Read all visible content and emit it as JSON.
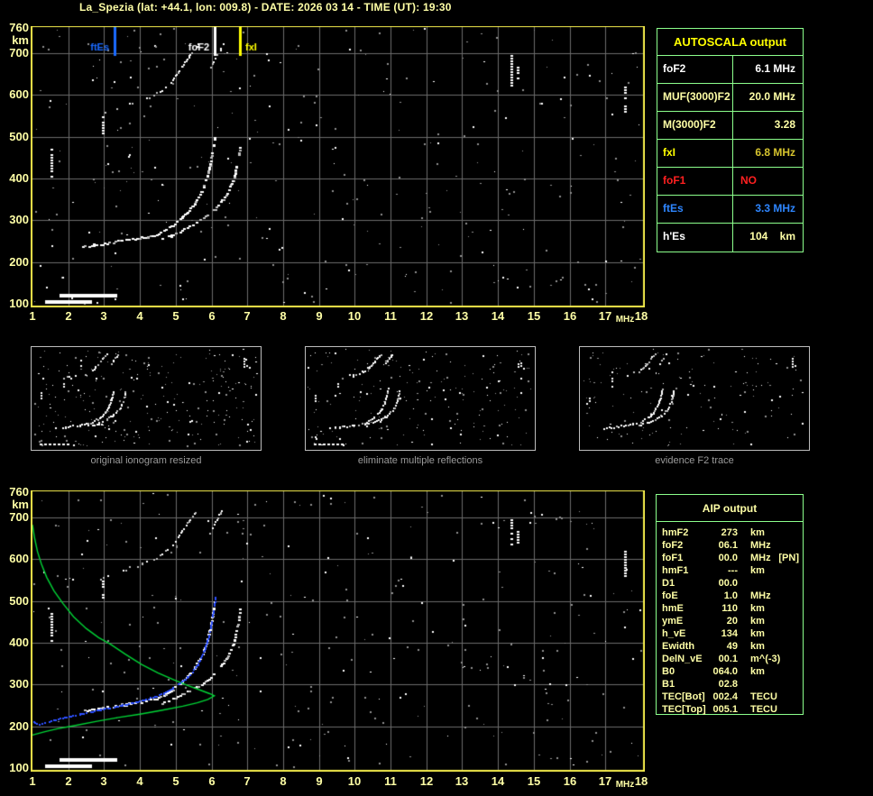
{
  "title": "La_Spezia (lat: +44.1, lon: 009.8) - DATE: 2026 03 14 - TIME (UT): 19:30",
  "colors": {
    "pale_yellow": "#ffffa6",
    "bright_yellow": "#ffff00",
    "table_green": "#8cff8c",
    "grid_gray": "#6b6b6b",
    "plot_border": "#f0e84a",
    "status_red": "#ff2020",
    "status_blue": "#2e86ff",
    "gold_value": "#d6c42e",
    "profile_green": "#00d435",
    "fitted_blue": "#2b4fff",
    "caption_gray": "#9b9b9b",
    "thumb_border": "#bdbdbd",
    "noise_gray": "#8f8f8f",
    "trace_white": "#ffffff"
  },
  "autoscala_table": {
    "header": "AUTOSCALA output",
    "rows": [
      {
        "label": "foF2",
        "value": "6.1 MHz",
        "label_color": "#ffffff",
        "value_color": "#ffffff",
        "value_align": "right"
      },
      {
        "label": "MUF(3000)F2",
        "value": "20.0 MHz",
        "label_color": "#ffffa6",
        "value_color": "#ffffa6",
        "value_align": "right"
      },
      {
        "label": "M(3000)F2",
        "value": "3.28",
        "label_color": "#ffffa6",
        "value_color": "#ffffa6",
        "value_align": "right"
      },
      {
        "label": "fxI",
        "value": "6.8 MHz",
        "label_color": "#ffff00",
        "value_color": "#d6c42e",
        "value_align": "right"
      },
      {
        "label": "foF1",
        "value": "NO",
        "label_color": "#ff2020",
        "value_color": "#ff2020",
        "value_align": "left"
      },
      {
        "label": "ftEs",
        "value": "3.3 MHz",
        "label_color": "#2e86ff",
        "value_color": "#2e86ff",
        "value_align": "right"
      },
      {
        "label": "h'Es",
        "value": "104    km",
        "label_color": "#ffffff",
        "value_color": "#ffffa6",
        "value_align": "right"
      }
    ]
  },
  "aip_table": {
    "header": "AIP output",
    "rows": [
      {
        "label": "hmF2",
        "value": "273",
        "unit": "km",
        "extra": ""
      },
      {
        "label": "foF2",
        "value": "06.1",
        "unit": "MHz",
        "extra": ""
      },
      {
        "label": "foF1",
        "value": "00.0",
        "unit": "MHz",
        "extra": "[PN]"
      },
      {
        "label": "hmF1",
        "value": "---",
        "unit": "km",
        "extra": ""
      },
      {
        "label": "D1",
        "value": "00.0",
        "unit": "",
        "extra": ""
      },
      {
        "label": "foE",
        "value": "1.0",
        "unit": "MHz",
        "extra": ""
      },
      {
        "label": "hmE",
        "value": "110",
        "unit": "km",
        "extra": ""
      },
      {
        "label": "ymE",
        "value": "20",
        "unit": "km",
        "extra": ""
      },
      {
        "label": "h_vE",
        "value": "134",
        "unit": "km",
        "extra": ""
      },
      {
        "label": "Ewidth",
        "value": "49",
        "unit": "km",
        "extra": ""
      },
      {
        "label": "DelN_vE",
        "value": "00.1",
        "unit": "m^(-3)",
        "extra": ""
      },
      {
        "label": "B0",
        "value": "064.0",
        "unit": "km",
        "extra": ""
      },
      {
        "label": "B1",
        "value": "02.8",
        "unit": "",
        "extra": ""
      },
      {
        "label": "TEC[Bot]",
        "value": "002.4",
        "unit": "TECU",
        "extra": ""
      },
      {
        "label": "TEC[Top]",
        "value": "005.1",
        "unit": "TECU",
        "extra": ""
      }
    ]
  },
  "thumbnails": [
    {
      "caption": "original ionogram resized"
    },
    {
      "caption": "eliminate multiple reflections"
    },
    {
      "caption": "evidence F2 trace"
    }
  ],
  "chart_data": {
    "type": "scatter",
    "title": "Ionogram with autoscaled traces",
    "x_axis": {
      "label": "MHz",
      "min": 1,
      "max": 18,
      "ticks": [
        1,
        2,
        3,
        4,
        5,
        6,
        7,
        8,
        9,
        10,
        11,
        12,
        13,
        14,
        15,
        16,
        17,
        18
      ]
    },
    "y_axis": {
      "label": "km",
      "min": 100,
      "max": 760,
      "ticks": [
        760,
        700,
        600,
        500,
        400,
        300,
        200,
        100
      ]
    },
    "grid": {
      "x_step_mhz": 1,
      "y_step_km": 100,
      "on": true
    },
    "markers": [
      {
        "name": "ftEs",
        "f_mhz": 3.3,
        "color": "#1a6aff",
        "label_side": "left"
      },
      {
        "name": "foF2",
        "f_mhz": 6.1,
        "color": "#ffffff",
        "label_side": "left"
      },
      {
        "name": "fxI",
        "f_mhz": 6.8,
        "color": "#ffff00",
        "label_side": "right"
      }
    ],
    "traces": {
      "f2_ordinary": [
        [
          2.38,
          238
        ],
        [
          2.7,
          242
        ],
        [
          3.0,
          246
        ],
        [
          3.3,
          250
        ],
        [
          3.6,
          254
        ],
        [
          3.9,
          258
        ],
        [
          4.2,
          262
        ],
        [
          4.45,
          267
        ],
        [
          4.7,
          278
        ],
        [
          4.95,
          294
        ],
        [
          5.15,
          308
        ],
        [
          5.35,
          325
        ],
        [
          5.5,
          342
        ],
        [
          5.65,
          362
        ],
        [
          5.75,
          382
        ],
        [
          5.85,
          405
        ],
        [
          5.92,
          428
        ],
        [
          5.98,
          455
        ],
        [
          6.03,
          480
        ],
        [
          6.06,
          498
        ]
      ],
      "f2_extraordinary": [
        [
          4.6,
          257
        ],
        [
          4.85,
          265
        ],
        [
          5.1,
          274
        ],
        [
          5.35,
          286
        ],
        [
          5.6,
          298
        ],
        [
          5.85,
          312
        ],
        [
          6.05,
          325
        ],
        [
          6.2,
          340
        ],
        [
          6.35,
          357
        ],
        [
          6.47,
          375
        ],
        [
          6.57,
          395
        ],
        [
          6.64,
          415
        ],
        [
          6.7,
          440
        ],
        [
          6.75,
          462
        ],
        [
          6.79,
          485
        ]
      ],
      "second_hop_band": [
        [
          2.88,
          556
        ],
        [
          3.1,
          565
        ],
        [
          3.35,
          572
        ],
        [
          3.6,
          578
        ],
        [
          3.85,
          583
        ],
        [
          4.05,
          590
        ],
        [
          4.25,
          598
        ],
        [
          4.45,
          606
        ]
      ],
      "second_hop_o": [
        [
          4.5,
          607
        ],
        [
          4.7,
          620
        ],
        [
          4.9,
          636
        ],
        [
          5.05,
          655
        ],
        [
          5.2,
          674
        ],
        [
          5.35,
          693
        ],
        [
          5.5,
          710
        ],
        [
          5.62,
          723
        ]
      ],
      "second_hop_x": [
        [
          5.93,
          662
        ],
        [
          6.03,
          680
        ],
        [
          6.13,
          697
        ],
        [
          6.23,
          711
        ],
        [
          6.31,
          722
        ]
      ],
      "vertical_echoes": [
        [
          1.52,
          400,
          470
        ],
        [
          2.96,
          505,
          548
        ],
        [
          14.37,
          622,
          695
        ],
        [
          14.56,
          640,
          668
        ],
        [
          17.55,
          558,
          620
        ]
      ],
      "e_region_bars": [
        [
          1.35,
          2.65,
          105,
          4
        ],
        [
          1.75,
          3.35,
          119,
          4
        ]
      ]
    },
    "profile_green": {
      "topside": [
        [
          1.0,
          682
        ],
        [
          1.06,
          650
        ],
        [
          1.14,
          618
        ],
        [
          1.25,
          588
        ],
        [
          1.4,
          556
        ],
        [
          1.6,
          524
        ],
        [
          1.85,
          494
        ],
        [
          2.15,
          462
        ],
        [
          2.5,
          434
        ],
        [
          2.85,
          412
        ],
        [
          3.15,
          398
        ],
        [
          3.6,
          372
        ],
        [
          4.05,
          348
        ],
        [
          4.5,
          328
        ],
        [
          4.95,
          311
        ],
        [
          5.35,
          297
        ],
        [
          5.7,
          286
        ],
        [
          5.95,
          278
        ],
        [
          6.08,
          273
        ]
      ],
      "bottomside": [
        [
          6.08,
          273
        ],
        [
          5.9,
          264
        ],
        [
          5.6,
          256
        ],
        [
          5.2,
          248
        ],
        [
          4.6,
          238
        ],
        [
          4.0,
          229
        ],
        [
          3.4,
          221
        ],
        [
          2.8,
          212
        ],
        [
          2.2,
          202
        ],
        [
          1.7,
          194
        ],
        [
          1.35,
          187
        ],
        [
          1.0,
          179
        ]
      ]
    },
    "fitted_trace_blue": [
      [
        1.02,
        211
      ],
      [
        1.1,
        207
      ],
      [
        1.25,
        208
      ],
      [
        1.45,
        213
      ],
      [
        1.7,
        219
      ],
      [
        2.0,
        225
      ],
      [
        2.3,
        230
      ],
      [
        2.6,
        236
      ],
      [
        2.9,
        241
      ],
      [
        3.2,
        246
      ],
      [
        3.5,
        252
      ],
      [
        3.8,
        258
      ],
      [
        4.1,
        264
      ],
      [
        4.4,
        272
      ],
      [
        4.65,
        281
      ],
      [
        4.9,
        293
      ],
      [
        5.1,
        305
      ],
      [
        5.3,
        318
      ],
      [
        5.45,
        332
      ],
      [
        5.6,
        350
      ],
      [
        5.72,
        370
      ],
      [
        5.82,
        392
      ],
      [
        5.9,
        415
      ],
      [
        5.97,
        442
      ],
      [
        6.02,
        468
      ],
      [
        6.07,
        495
      ],
      [
        6.1,
        510
      ]
    ],
    "noise_seeds": [
      11,
      22,
      33,
      44,
      55
    ]
  }
}
